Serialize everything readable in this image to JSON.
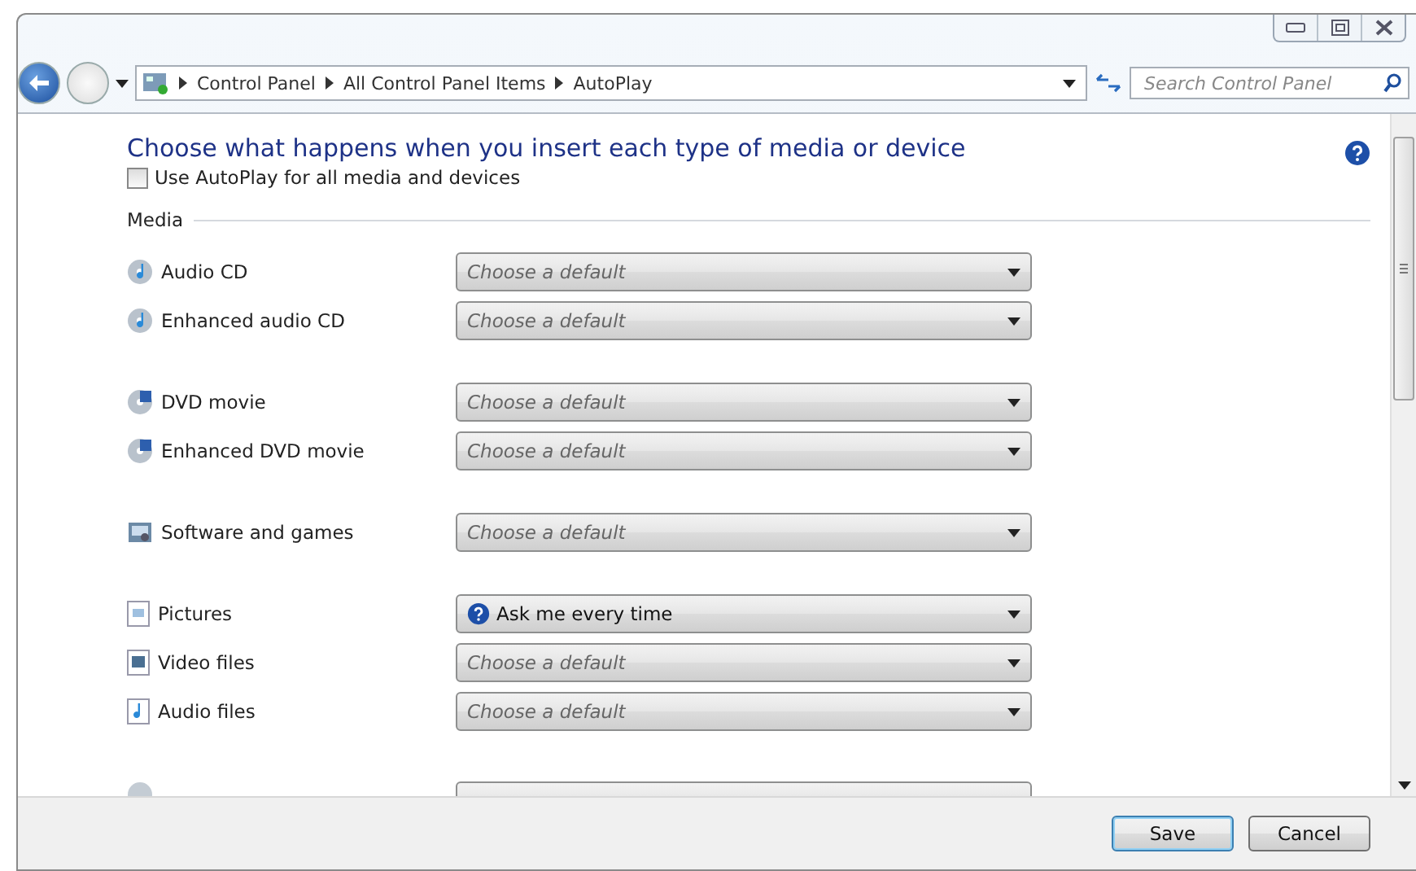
{
  "address_bar": {
    "breadcrumbs": [
      "Control Panel",
      "All Control Panel Items",
      "AutoPlay"
    ]
  },
  "search": {
    "placeholder": "Search Control Panel"
  },
  "heading": "Choose what happens when you insert each type of media or device",
  "use_autoplay": {
    "label": "Use AutoPlay for all media and devices",
    "checked": false
  },
  "section": "Media",
  "groups": [
    [
      {
        "kind": "cd",
        "label": "Audio CD",
        "placeholder": "Choose a default"
      },
      {
        "kind": "cd",
        "label": "Enhanced audio CD",
        "placeholder": "Choose a default"
      }
    ],
    [
      {
        "kind": "dvd",
        "label": "DVD movie",
        "placeholder": "Choose a default"
      },
      {
        "kind": "dvd",
        "label": "Enhanced DVD movie",
        "placeholder": "Choose a default"
      }
    ],
    [
      {
        "kind": "software",
        "label": "Software and games",
        "placeholder": "Choose a default"
      }
    ],
    [
      {
        "kind": "picture",
        "label": "Pictures",
        "value": "Ask me every time"
      },
      {
        "kind": "video",
        "label": "Video files",
        "placeholder": "Choose a default"
      },
      {
        "kind": "audio",
        "label": "Audio files",
        "placeholder": "Choose a default"
      }
    ]
  ],
  "buttons": [
    {
      "label": "Save",
      "selected": true
    },
    {
      "label": "Cancel",
      "selected": false
    }
  ]
}
